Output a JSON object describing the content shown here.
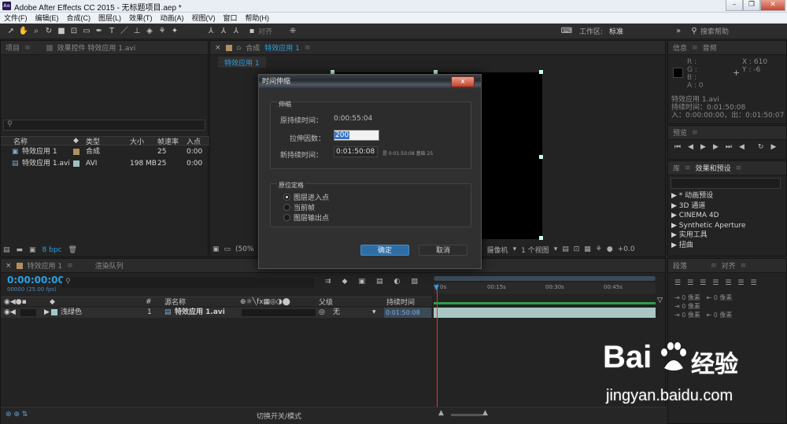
{
  "window": {
    "app_icon": "Ae",
    "title": "Adobe After Effects CC 2015 - 无标题项目.aep *",
    "minimize": "–",
    "restore": "❐",
    "close": "✕"
  },
  "menu": [
    "文件(F)",
    "编辑(E)",
    "合成(C)",
    "图层(L)",
    "效果(T)",
    "动画(A)",
    "视图(V)",
    "窗口",
    "帮助(H)"
  ],
  "toolbar": {
    "snap_label": "对齐",
    "workspace_label": "工作区:",
    "workspace_value": "标准",
    "search_placeholder": "搜索帮助"
  },
  "project_panel": {
    "tab_project": "项目",
    "tab_effects": "效果控件 特效应用 1.avi",
    "columns": [
      "名称",
      "类型",
      "大小",
      "帧速率",
      "入点"
    ],
    "items": [
      {
        "name": "特效应用 1",
        "type": "合成",
        "size": "",
        "fps": "25",
        "in": "0:00",
        "color": "#b09060"
      },
      {
        "name": "特效应用 1.avi",
        "type": "AVI",
        "size": "198 MB",
        "fps": "25",
        "in": "0:00",
        "color": "#a0c0c0"
      }
    ],
    "bpc": "8 bpc"
  },
  "comp_panel": {
    "tab_prefix": "合成",
    "tab_name": "特效应用 1",
    "comp_tab": "特效应用 1",
    "zoom": "(50%",
    "camera": "摄像机",
    "views": "1 个视图",
    "exposure": "+0.0"
  },
  "dialog": {
    "title": "时间伸缩",
    "close": "x",
    "stretch_group": "伸缩",
    "original_duration_label": "原持续时间：",
    "original_duration": "0:00:55:04",
    "factor_label": "拉伸因数：",
    "factor_value": "200",
    "new_duration_label": "新持续时间：",
    "new_duration": "0:01:50:08",
    "new_duration_hint": "是 0:01:50:08  基础 25",
    "hold_group": "原位定格",
    "options": [
      "图层进入点",
      "当前帧",
      "图层输出点"
    ],
    "selected_option": 0,
    "ok": "确定",
    "cancel": "取消"
  },
  "info_panel": {
    "tab_info": "信息",
    "tab_audio": "音频",
    "r": "R :",
    "g": "G :",
    "b": "B :",
    "a": "A : 0",
    "x": "X : 610",
    "y": "Y : -6",
    "line1": "特效应用 1.avi",
    "line2": "持续时间：0:01:50:08",
    "line3": "入：0:00:00:00，出：0:01:50:07"
  },
  "preview_panel": {
    "tab": "预览"
  },
  "effects_panel": {
    "tab_lib": "库",
    "tab_effects": "效果和预设",
    "items": [
      "* 动画预设",
      "3D 通道",
      "CINEMA 4D",
      "Synthetic Aperture",
      "实用工具",
      "扭曲"
    ]
  },
  "timeline": {
    "tab_comp": "特效应用 1",
    "tab_render": "渲染队列",
    "timecode": "0:00:00:00",
    "timecode_sub": "00000 (25.00 fps)",
    "columns": {
      "num": "#",
      "source": "源名称",
      "parent": "父级",
      "duration": "持续时间"
    },
    "ruler": [
      "0s",
      "00:15s",
      "00:30s",
      "00:45s"
    ],
    "layer": {
      "label": "浅绿色",
      "num": "1",
      "name": "特效应用 1.avi",
      "parent": "无",
      "duration": "0:01:50:08"
    },
    "bottom_label": "切换开关/模式"
  },
  "right_lower": {
    "tab_paragraph": "段落",
    "tab_align": "对齐",
    "px_values": [
      "0 像素",
      "0 像素",
      "0 像素",
      "0 像素",
      "0 像素"
    ]
  },
  "watermark": {
    "brand": "Bai",
    "brand2": "经验",
    "url": "jingyan.baidu.com"
  }
}
